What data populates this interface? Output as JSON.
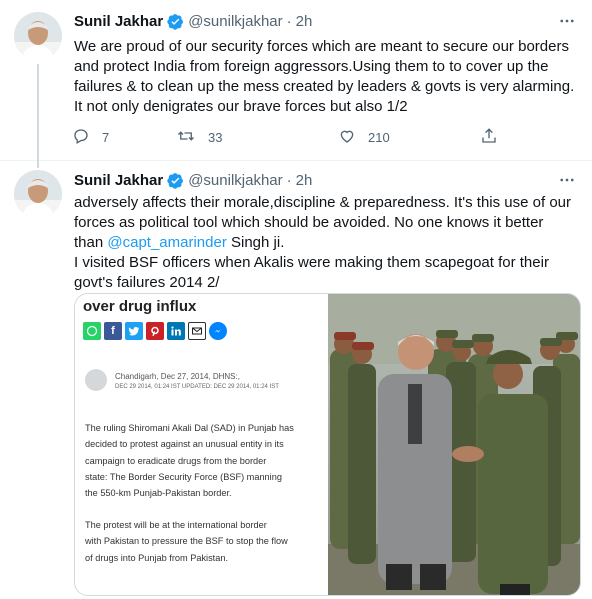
{
  "tweets": [
    {
      "author": "Sunil Jakhar",
      "handle": "@sunilkjakhar",
      "separator": "·",
      "time": "2h",
      "lines": [
        "We are proud of our security forces which are meant to secure our borders",
        "and protect India from foreign aggressors.Using them to  to cover up the",
        "failures & to clean up the mess created by leaders & govts is very alarming.",
        "It not only denigrates our brave forces but also 1/2"
      ],
      "actions": {
        "replies": "7",
        "retweets": "33",
        "likes": "210"
      }
    },
    {
      "author": "Sunil Jakhar",
      "handle": "@sunilkjakhar",
      "separator": "·",
      "time": "2h",
      "lines": [
        "adversely affects their morale,discipline & preparedness. It's this use of our",
        "forces as political tool which should be avoided. No one knows it better",
        "I visited BSF officers when Akalis were making them scapegoat for their",
        "govt's  failures 2014 2/"
      ],
      "line3_pre": "than ",
      "mention": "@capt_amarinder",
      "line3_post": " Singh ji."
    }
  ],
  "clipping": {
    "headline": "over drug influx",
    "byline": "Chandigarh, Dec 27, 2014, DHNS:,",
    "dateline": "DEC 29 2014, 01:24 IST UPDATED: DEC 29 2014, 01:24 IST",
    "para1": [
      "The ruling Shiromani Akali Dal (SAD) in Punjab has",
      "decided to protest against an unusual entity in its",
      "campaign to eradicate drugs from the border",
      "state: The Border Security Force (BSF) manning",
      "the 550-km Punjab-Pakistan border."
    ],
    "para2": [
      "The protest will be at the international border",
      "with Pakistan to pressure the BSF to stop the flow",
      "of drugs into Punjab from Pakistan."
    ]
  },
  "colors": {
    "accent": "#1d9bf0",
    "muted": "#536471",
    "text": "#0f1419",
    "border": "#eff3f4"
  },
  "icons": [
    "verified-badge-icon",
    "more-icon",
    "reply-icon",
    "retweet-icon",
    "like-icon",
    "share-icon",
    "whatsapp-icon",
    "facebook-icon",
    "twitter-icon",
    "pinterest-icon",
    "linkedin-icon",
    "email-icon",
    "messenger-icon"
  ]
}
